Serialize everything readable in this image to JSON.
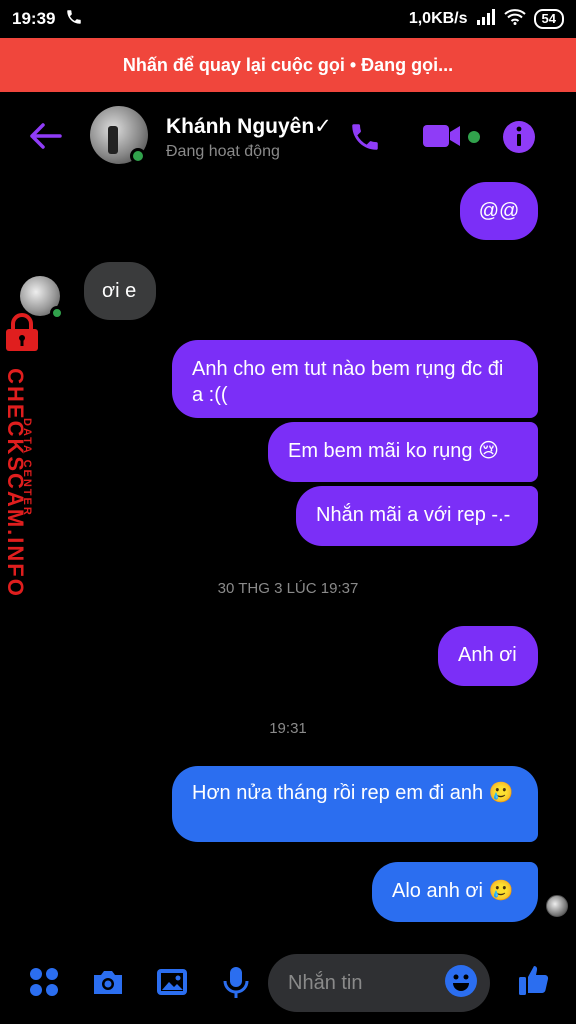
{
  "status_bar": {
    "time": "19:39",
    "speed": "1,0KB/s",
    "battery": "54"
  },
  "call_banner": {
    "text": "Nhấn để quay lại cuộc gọi • Đang gọi..."
  },
  "header": {
    "name": "Khánh Nguyên✓",
    "status": "Đang hoạt động"
  },
  "messages": [
    {
      "side": "out",
      "text": "@@"
    },
    {
      "side": "in",
      "text": "ơi e"
    },
    {
      "side": "out",
      "text": "Anh cho em tut nào bem rụng đc đi a :(("
    },
    {
      "side": "out",
      "text": "Em bem mãi ko rụng 😢"
    },
    {
      "side": "out",
      "text": "Nhắn mãi a với rep -.-"
    },
    {
      "side": "out",
      "text": "Anh ơi"
    },
    {
      "side": "out",
      "text": "Hơn nửa tháng rồi rep em đi anh 🥲"
    },
    {
      "side": "out",
      "text": "Alo anh ơi 🥲"
    }
  ],
  "timestamps": {
    "t1": "30 THG 3 LÚC 19:37",
    "t2": "19:31"
  },
  "watermark": {
    "big": "CHECKSCAM.INFO",
    "small": "DATA CENTER"
  },
  "composer": {
    "placeholder": "Nhắn tin"
  },
  "colors": {
    "accent": "#7b2ff7",
    "blue": "#2b6ef0",
    "banner": "#f0463c",
    "online": "#31a24c"
  }
}
